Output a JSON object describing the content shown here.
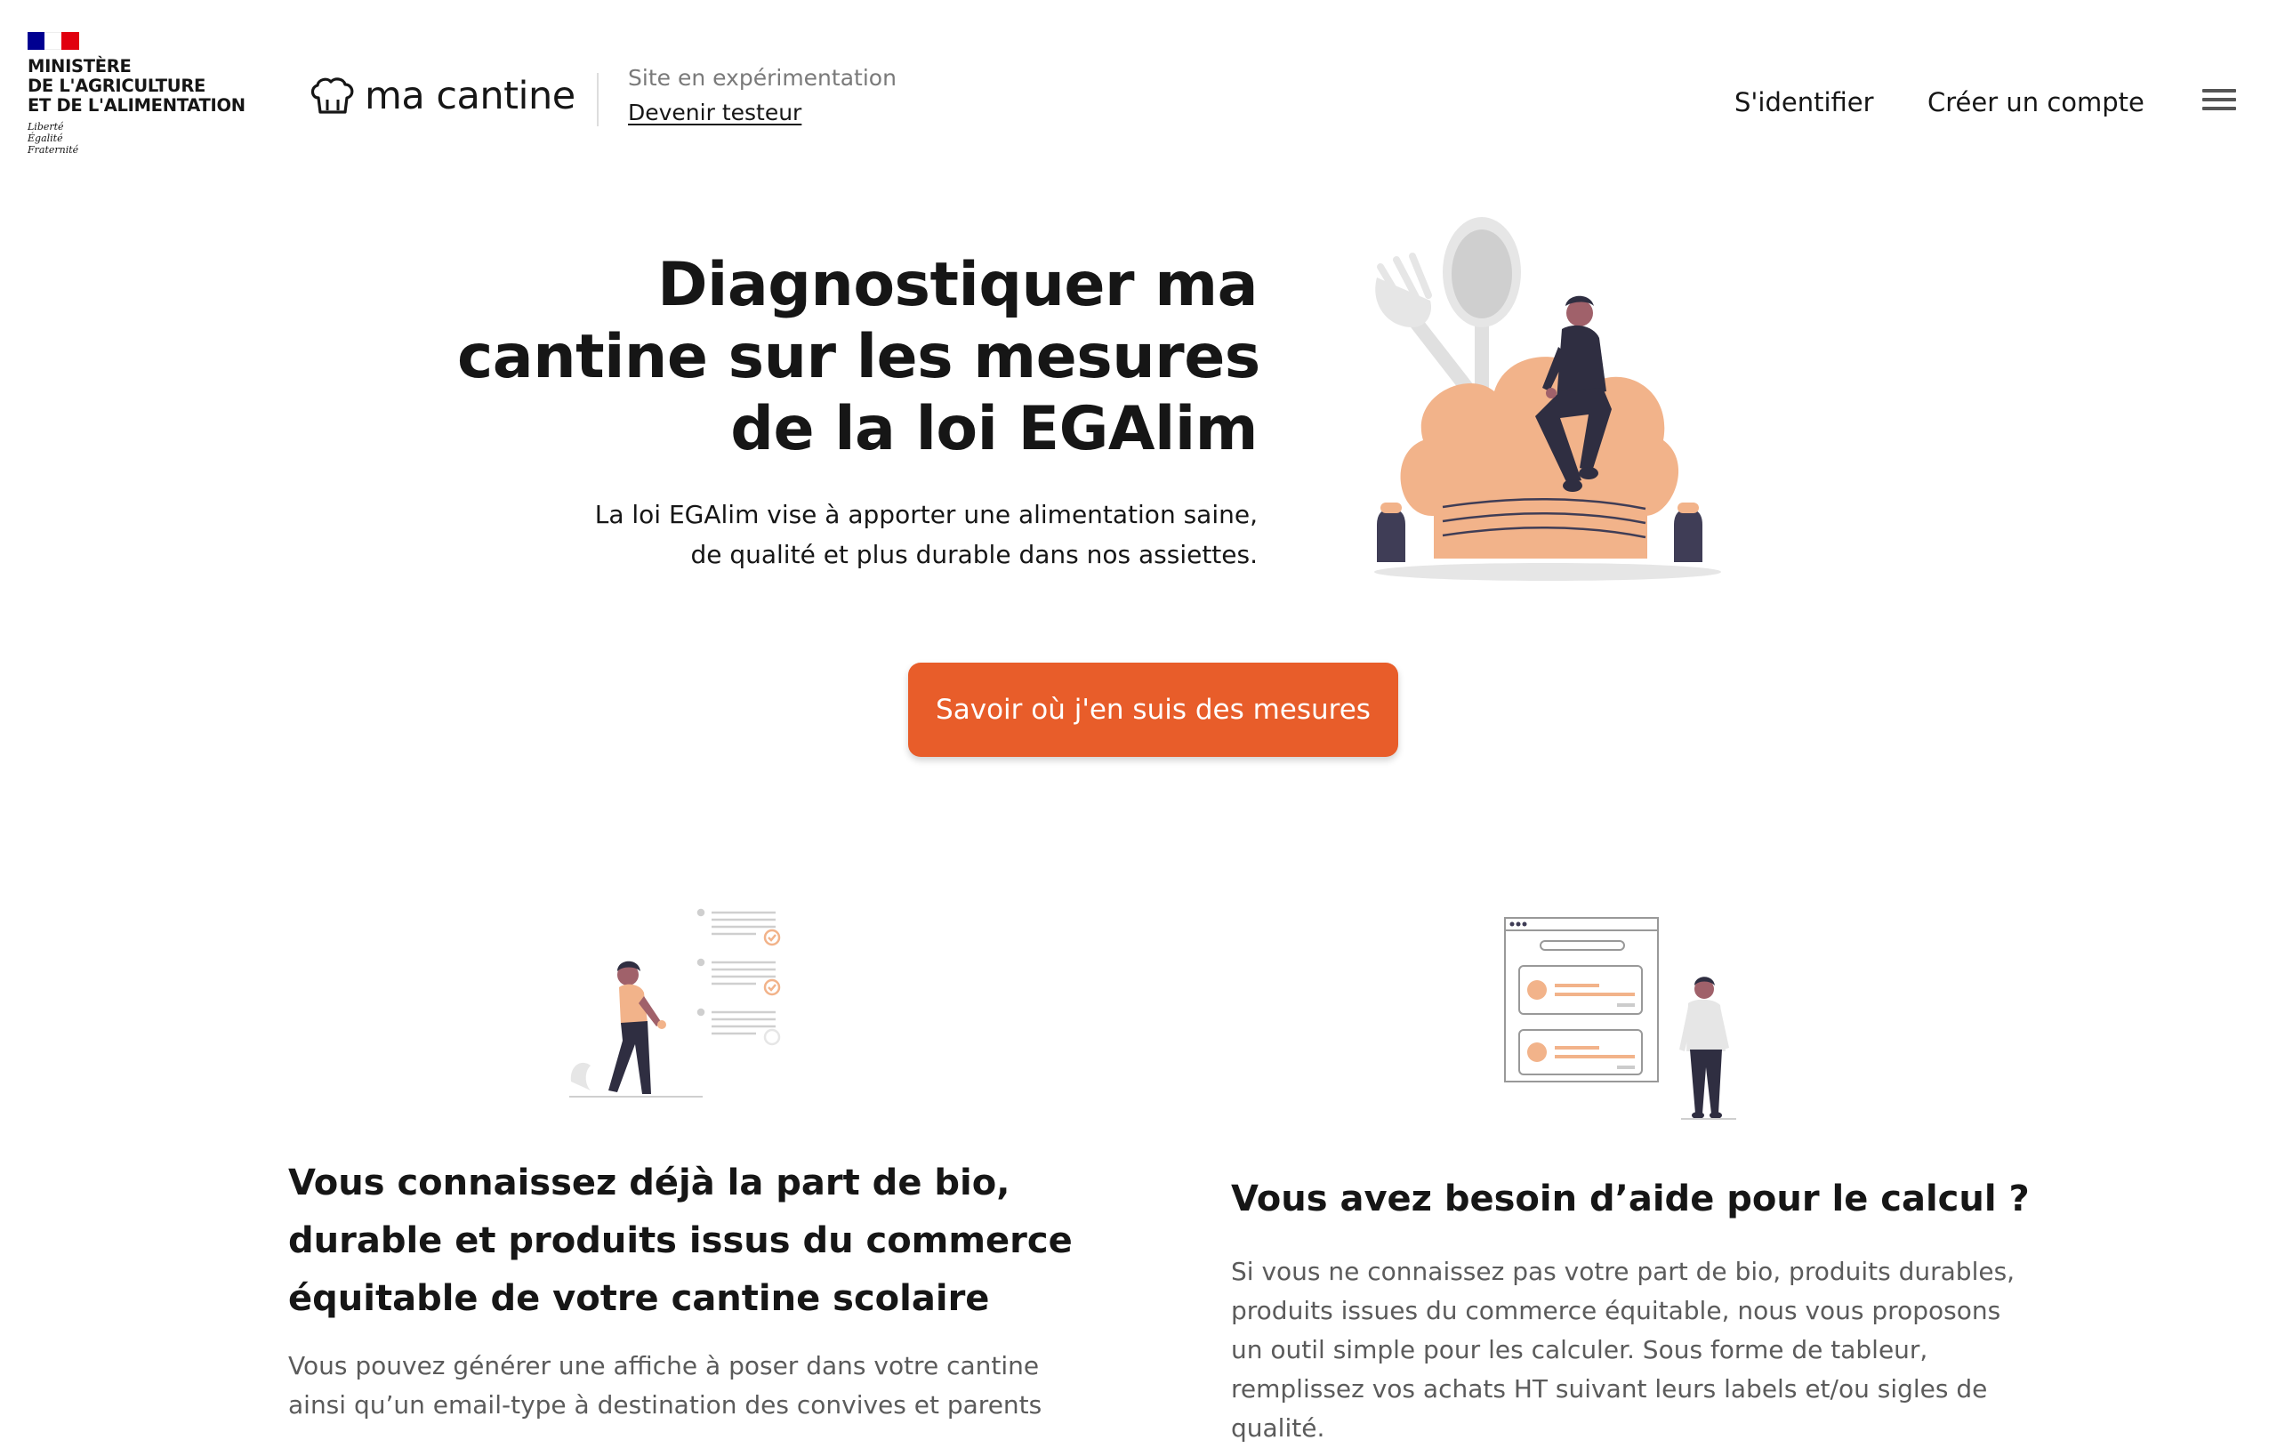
{
  "header": {
    "ministry_lines": [
      "MINISTÈRE",
      "DE L'AGRICULTURE",
      "ET DE L'ALIMENTATION"
    ],
    "devise_lines": [
      "Liberté",
      "Égalité",
      "Fraternité"
    ],
    "brand_name": "ma cantine",
    "experiment_label": "Site en expérimentation",
    "tester_link": "Devenir testeur",
    "login_label": "S'identifier",
    "signup_label": "Créer un compte",
    "menu_icon": "hamburger-icon",
    "brand_icon": "chef-hat-icon"
  },
  "hero": {
    "title_lines": [
      "Diagnostiquer ma",
      "cantine sur les mesures",
      "de la loi EGAlim"
    ],
    "subtitle_lines": [
      "La loi EGAlim vise à apporter une alimentation saine,",
      "de qualité et plus durable dans nos assiettes."
    ],
    "cta_label": "Savoir où j'en suis des mesures"
  },
  "cards": [
    {
      "title_lines": [
        "Vous connaissez déjà la part de bio,",
        "durable et produits issus du commerce",
        "équitable de votre cantine scolaire"
      ],
      "text_lines": [
        "Vous pouvez générer une affiche à poser dans votre cantine",
        "ainsi qu’un email-type à destination des convives et parents"
      ]
    },
    {
      "title": "Vous avez besoin d’aide pour le calcul ?",
      "text_lines": [
        "Si vous ne connaissez pas votre part de bio, produits durables,",
        "produits issues du commerce équitable, nous vous proposons",
        "un outil simple pour les calculer. Sous forme de tableur,",
        "remplissez vos achats HT suivant leurs labels et/ou sigles de",
        "qualité."
      ]
    }
  ],
  "colors": {
    "accent": "#e85d2a",
    "text": "#161616",
    "muted": "#5b5b5b",
    "illustration_orange": "#f2b38a",
    "illustration_dark": "#2f2e41"
  }
}
